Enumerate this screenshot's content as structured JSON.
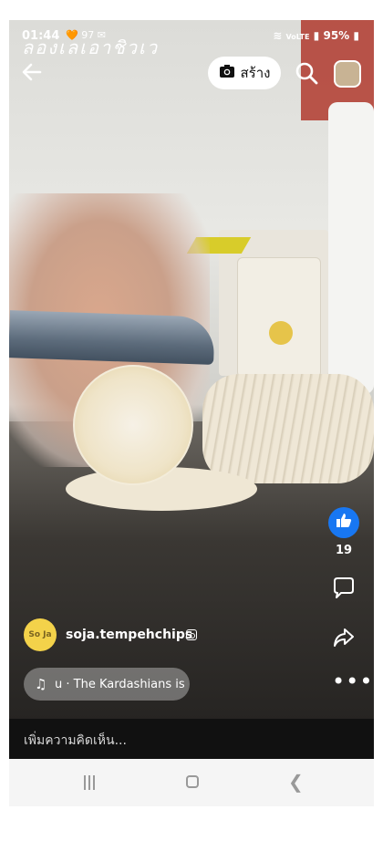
{
  "status_bar": {
    "time": "01:44",
    "notif_icons": "97",
    "signal": "VoLTE",
    "battery": "95%"
  },
  "overlay_text": "ลองเลเอาชิวเว",
  "top_bar": {
    "create_label": "สร้าง"
  },
  "reel": {
    "likes_count": "19",
    "creator_name": "soja.tempehchips",
    "avatar_text": "So Ja",
    "music_text": "u · The Kardashians is"
  },
  "comment_bar": {
    "placeholder": "เพิ่มความคิดเห็น..."
  },
  "colors": {
    "like_button": "#1877f2",
    "avatar_bg": "#f3d24a"
  }
}
